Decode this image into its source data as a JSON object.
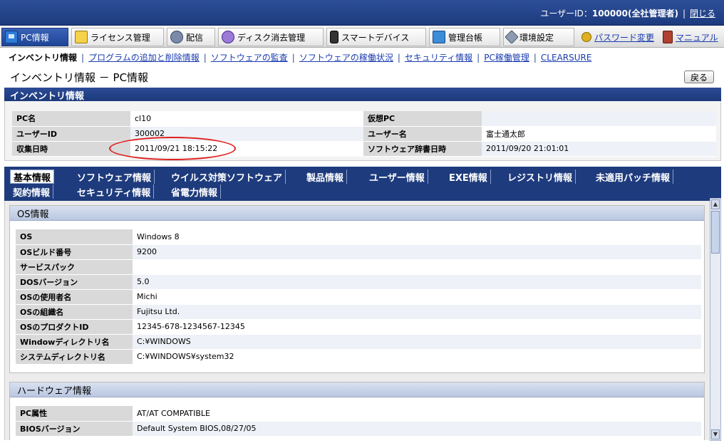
{
  "topbar": {
    "user_prefix": "ユーザーID：",
    "user_value": "100000(全社管理者)",
    "close_label": "閉じる"
  },
  "mainmenu": {
    "pc_info": "PC情報",
    "license": "ライセンス管理",
    "distribution": "配信",
    "disk_erase": "ディスク消去管理",
    "smart_device": "スマートデバイス",
    "ledger": "管理台帳",
    "environment": "環境設定",
    "password_change": "パスワード変更",
    "manual": "マニュアル"
  },
  "submenu": {
    "current": "インベントリ情報",
    "links": [
      "プログラムの追加と削除情報",
      "ソフトウェアの監査",
      "ソフトウェアの稼働状況",
      "セキュリティ情報",
      "PC稼働管理",
      "CLEARSURE"
    ]
  },
  "page": {
    "title": "インベントリ情報 － PC情報",
    "back_label": "戻る",
    "section_title": "インベントリ情報"
  },
  "summary": {
    "pc_name_label": "PC名",
    "pc_name": "cl10",
    "virtual_pc_label": "仮想PC",
    "virtual_pc": "",
    "user_id_label": "ユーザーID",
    "user_id": "300002",
    "user_name_label": "ユーザー名",
    "user_name": "富士通太郎",
    "collected_label": "収集日時",
    "collected": "2011/09/21 18:15:22",
    "dictionary_label": "ソフトウェア辞書日時",
    "dictionary": "2011/09/20 21:01:01"
  },
  "tabs": [
    "基本情報",
    "ソフトウェア情報",
    "ウイルス対策ソフトウェア",
    "製品情報",
    "ユーザー情報",
    "EXE情報",
    "レジストリ情報",
    "未適用パッチ情報",
    "契約情報",
    "セキュリティ情報",
    "省電力情報"
  ],
  "os_section": {
    "title": "OS情報",
    "rows": [
      {
        "label": "OS",
        "value": "Windows 8"
      },
      {
        "label": "OSビルド番号",
        "value": "9200"
      },
      {
        "label": "サービスパック",
        "value": ""
      },
      {
        "label": "DOSバージョン",
        "value": "5.0"
      },
      {
        "label": "OSの使用者名",
        "value": "Michi"
      },
      {
        "label": "OSの組織名",
        "value": "Fujitsu  Ltd."
      },
      {
        "label": "OSのプロダクトID",
        "value": "12345-678-1234567-12345"
      },
      {
        "label": "Windowディレクトリ名",
        "value": "C:¥WINDOWS"
      },
      {
        "label": "システムディレクトリ名",
        "value": "C:¥WINDOWS¥system32"
      }
    ]
  },
  "hw_section": {
    "title": "ハードウェア情報",
    "rows": [
      {
        "label": "PC属性",
        "value": "AT/AT COMPATIBLE"
      },
      {
        "label": "BIOSバージョン",
        "value": "Default System BIOS,08/27/05"
      }
    ]
  }
}
